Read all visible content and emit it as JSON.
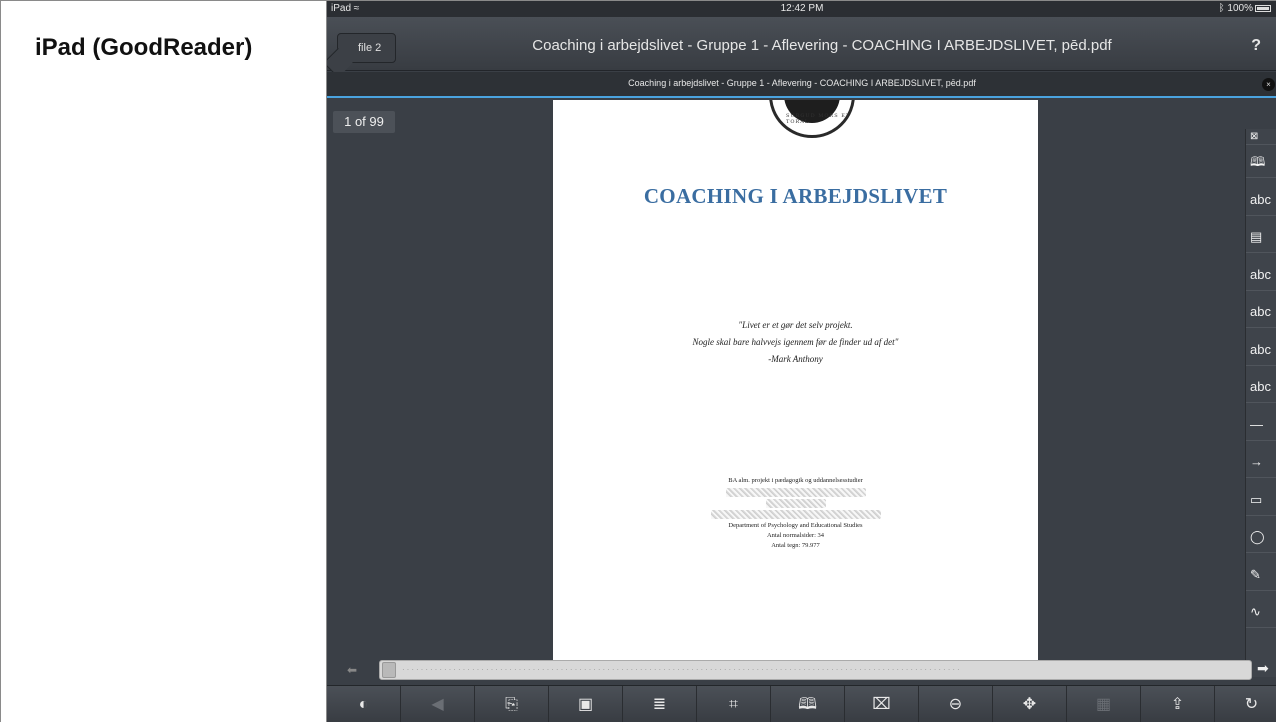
{
  "caption": "iPad (GoodReader)",
  "statusbar": {
    "device": "iPad",
    "wifi_icon": "wifi-icon",
    "time": "12:42 PM",
    "battery": "100%",
    "bluetooth_icon": "bluetooth-icon"
  },
  "navbar": {
    "back_label": "file 2",
    "title": "Coaching i arbejdslivet - Gruppe 1 - Aflevering - COACHING I ARBEJDSLIVET, pēd.pdf",
    "help_label": "?"
  },
  "subbar": {
    "title": "Coaching i arbejdslivet - Gruppe 1 - Aflevering - COACHING I ARBEJDSLIVET, pēd.pdf",
    "close_label": "×"
  },
  "page_counter": "1 of 99",
  "document": {
    "seal_text": "SURGUD MORS ET TORAL",
    "title": "COACHING I ARBEJDSLIVET",
    "quote_lines": [
      "\"Livet er et gør det selv projekt.",
      "Nogle skal bare halvvejs igennem før de finder ud af det\"",
      "-Mark Anthony"
    ],
    "info_top": "BA alm. projekt i pædagogik og uddannelsesstudier",
    "info_lines": [
      "Department of Psychology and Educational Studies",
      "Antal normalsider: 34",
      "Antal tegn: 79.977"
    ]
  },
  "tools": [
    {
      "label": "⊠",
      "name": "panel-close-icon"
    },
    {
      "label": "🕮",
      "name": "bookmark-book-icon"
    },
    {
      "label": "abc",
      "name": "text-tool-icon"
    },
    {
      "label": "▤",
      "name": "comment-note-icon"
    },
    {
      "label": "abc",
      "name": "highlight-tool-icon"
    },
    {
      "label": "abc",
      "name": "underline-tool-icon"
    },
    {
      "label": "abc",
      "name": "squiggly-tool-icon"
    },
    {
      "label": "abc",
      "name": "strikeout-tool-icon"
    },
    {
      "label": "—",
      "name": "line-tool-icon"
    },
    {
      "label": "→",
      "name": "arrow-tool-icon"
    },
    {
      "label": "▭",
      "name": "rectangle-tool-icon"
    },
    {
      "label": "◯",
      "name": "oval-tool-icon"
    },
    {
      "label": "✎",
      "name": "pen-tool-icon"
    },
    {
      "label": "∿",
      "name": "freehand-tool-icon"
    }
  ],
  "scrubber": {
    "left_arrow": "⬅",
    "right_arrow": "➡",
    "position": 0.0
  },
  "bottom_toolbar": [
    {
      "label": "◐",
      "name": "night-mode-icon",
      "enabled": true
    },
    {
      "label": "◀",
      "name": "back-arrow-icon",
      "enabled": false
    },
    {
      "label": "⎘",
      "name": "goto-page-icon",
      "enabled": true
    },
    {
      "label": "▣",
      "name": "page-view-icon",
      "enabled": true
    },
    {
      "label": "≣",
      "name": "text-reflow-icon",
      "enabled": true
    },
    {
      "label": "⌗",
      "name": "crop-icon",
      "enabled": true
    },
    {
      "label": "🕮",
      "name": "bookmarks-icon",
      "enabled": true
    },
    {
      "label": "⌧",
      "name": "page-number-icon",
      "enabled": true
    },
    {
      "label": "⊖",
      "name": "zoom-out-icon",
      "enabled": true
    },
    {
      "label": "✥",
      "name": "move-icon",
      "enabled": true
    },
    {
      "label": "▦",
      "name": "thumbnails-icon",
      "enabled": false
    },
    {
      "label": "⇪",
      "name": "share-icon",
      "enabled": true
    },
    {
      "label": "↻",
      "name": "rotate-icon",
      "enabled": true
    }
  ],
  "colors": {
    "accent_blue": "#4aa3df",
    "title_blue": "#3a6da1",
    "chrome_dark": "#3a3f46"
  }
}
